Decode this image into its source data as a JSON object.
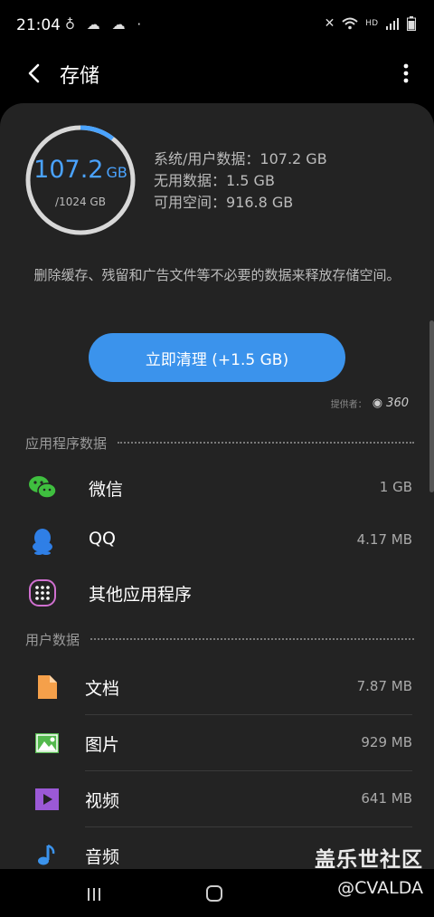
{
  "status_bar": {
    "time": "21:04",
    "left_icons": [
      "notification-icon",
      "wechat-icon",
      "wechat-icon",
      "dot-icon"
    ],
    "right_icons": [
      "mute-icon",
      "wifi-icon",
      "hd-icon",
      "signal-icon",
      "battery-icon"
    ],
    "hd_label": "HD"
  },
  "app_bar": {
    "title": "存储"
  },
  "storage": {
    "used_value": "107.2",
    "used_unit": "GB",
    "total": "/1024 GB",
    "used_fraction": 0.105,
    "accent_color": "#4aa3ff",
    "stats": [
      {
        "label": "系统/用户数据：",
        "value": "107.2 GB"
      },
      {
        "label": "无用数据：",
        "value": "1.5 GB"
      },
      {
        "label": "可用空间：",
        "value": "916.8 GB"
      }
    ]
  },
  "description": "删除缓存、残留和广告文件等不必要的数据来释放存储空间。",
  "clean_button": {
    "label": "立即清理 (+1.5 GB)",
    "color": "#3b93ec"
  },
  "provider": {
    "label": "提供者：",
    "logo_text": "360"
  },
  "app_section": {
    "title": "应用程序数据",
    "items": [
      {
        "name": "微信",
        "size": "1 GB",
        "icon": "wechat-icon"
      },
      {
        "name": "QQ",
        "size": "4.17 MB",
        "icon": "qq-icon"
      },
      {
        "name": "其他应用程序",
        "size": "",
        "icon": "apps-grid-icon"
      }
    ]
  },
  "user_section": {
    "title": "用户数据",
    "items": [
      {
        "name": "文档",
        "size": "7.87 MB",
        "icon": "document-icon"
      },
      {
        "name": "图片",
        "size": "929 MB",
        "icon": "image-icon"
      },
      {
        "name": "视频",
        "size": "641 MB",
        "icon": "video-icon"
      },
      {
        "name": "音频",
        "size": "",
        "icon": "audio-icon"
      }
    ]
  },
  "watermark": {
    "line1": "盖乐世社区",
    "line2": "@CVALDA"
  }
}
